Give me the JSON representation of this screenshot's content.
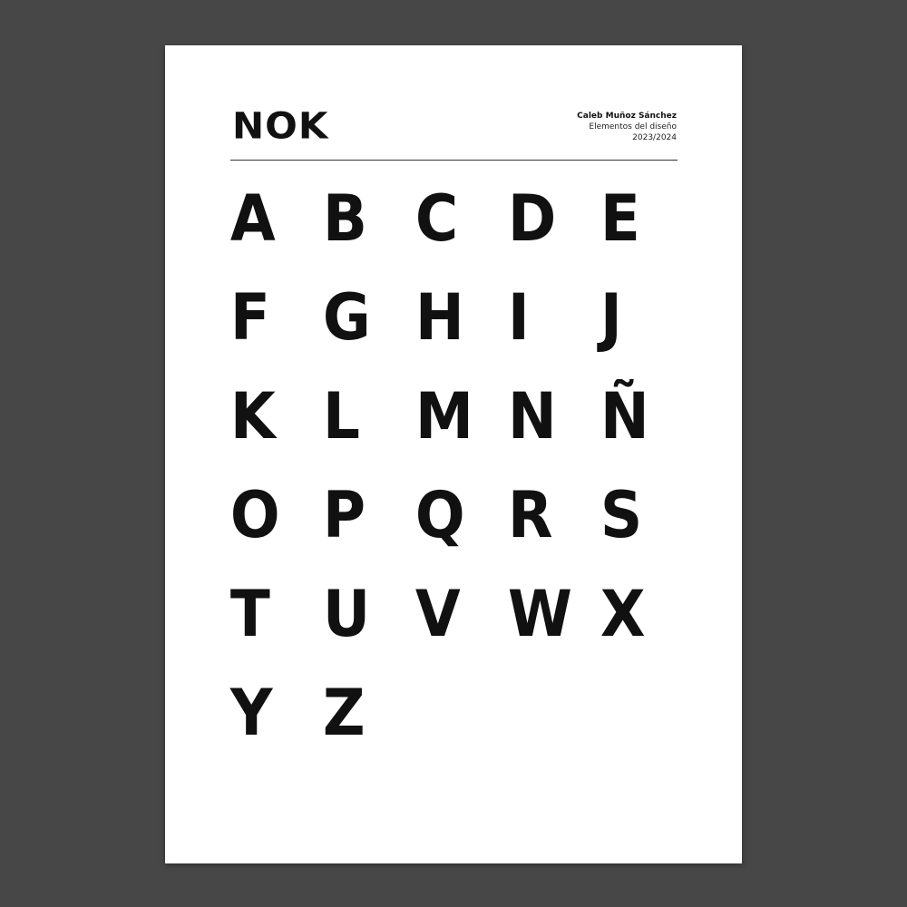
{
  "poster": {
    "title": "NOK",
    "author": "Caleb Muñoz Sánchez",
    "course": "Elementos del diseño",
    "year": "2023/2024"
  },
  "alphabet": [
    "A",
    "B",
    "C",
    "D",
    "E",
    "F",
    "G",
    "H",
    "I",
    "J",
    "K",
    "L",
    "M",
    "N",
    "Ñ",
    "O",
    "P",
    "Q",
    "R",
    "S",
    "T",
    "U",
    "V",
    "W",
    "X",
    "Y",
    "Z"
  ]
}
